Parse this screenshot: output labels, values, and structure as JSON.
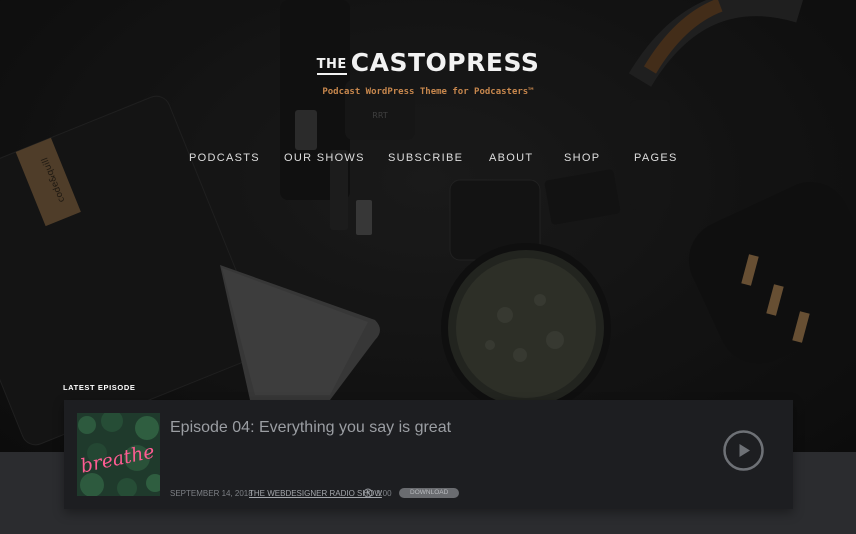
{
  "brand": {
    "the": "THE",
    "name": "CASTOPRESS",
    "tagline": "Podcast WordPress Theme for Podcasters™"
  },
  "nav": [
    {
      "label": "PODCASTS"
    },
    {
      "label": "OUR SHOWS"
    },
    {
      "label": "SUBSCRIBE"
    },
    {
      "label": "ABOUT"
    },
    {
      "label": "SHOP"
    },
    {
      "label": "PAGES"
    }
  ],
  "latest": {
    "heading": "LATEST EPISODE",
    "title": "Episode 04: Everything you say is great",
    "date": "SEPTEMBER 14, 2018",
    "show": "THE WEBDESIGNER RADIO SHOW",
    "duration": "3:00",
    "download_label": "DOWNLOAD",
    "thumbnail_text": "breathe"
  },
  "colors": {
    "accent": "#c7874d",
    "card": "#1d1e21",
    "page_bg": "#2b2c2f",
    "neon": "#e8407a"
  },
  "icons": {
    "clock": "clock-icon",
    "play": "play-icon"
  }
}
